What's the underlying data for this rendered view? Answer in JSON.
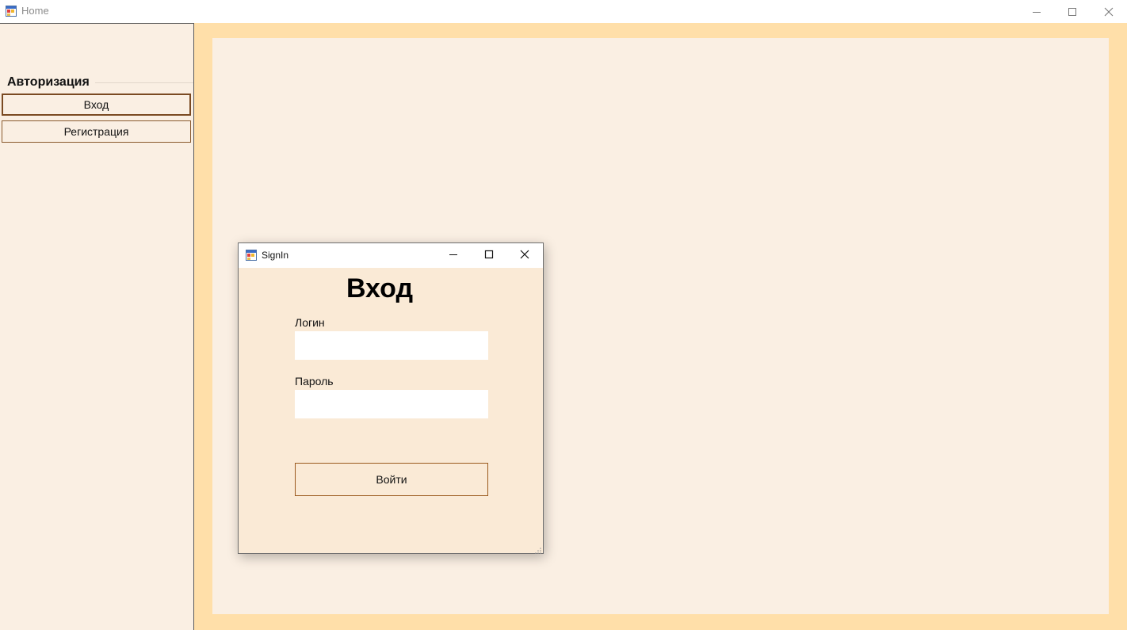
{
  "window": {
    "title": "Home",
    "icon": "app-form-icon",
    "controls": [
      "minimize-icon",
      "maximize-icon",
      "close-icon"
    ]
  },
  "sidebar": {
    "group_title": "Авторизация",
    "items": [
      {
        "label": "Вход",
        "active": true
      },
      {
        "label": "Регистрация",
        "active": false
      }
    ]
  },
  "signin_dialog": {
    "title": "SignIn",
    "icon": "app-form-icon",
    "heading": "Вход",
    "login_label": "Логин",
    "login_value": "",
    "password_label": "Пароль",
    "password_value": "",
    "submit_label": "Войти"
  },
  "colors": {
    "panel_background": "#faefe3",
    "main_border": "#ffdfa9",
    "dialog_background": "#faead6",
    "button_border": "#9a5a1e"
  }
}
